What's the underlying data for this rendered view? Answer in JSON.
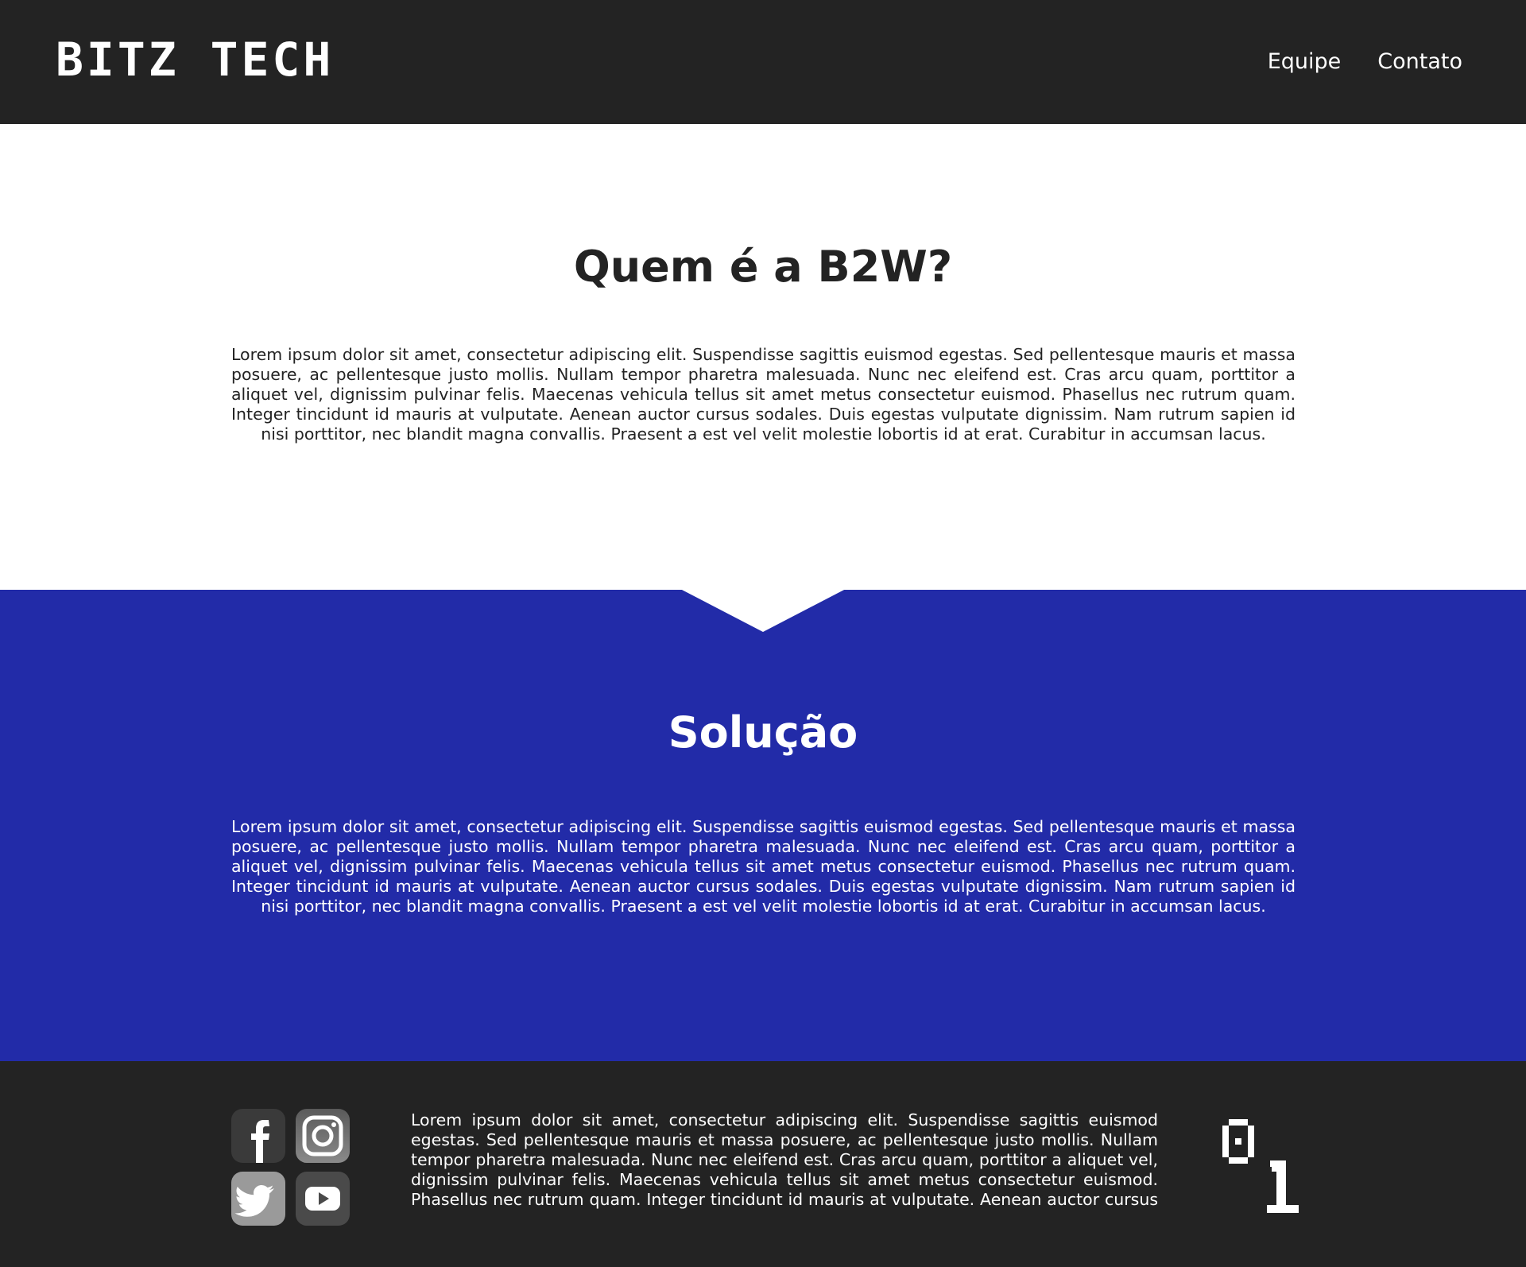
{
  "header": {
    "logo": "BITZ TECH",
    "nav": [
      {
        "label": "Equipe"
      },
      {
        "label": "Contato"
      }
    ]
  },
  "about": {
    "title": "Quem é a B2W?",
    "text": "Lorem ipsum dolor sit amet, consectetur adipiscing elit. Suspendisse sagittis euismod egestas. Sed pellentesque mauris et massa posuere, ac pellentesque justo mollis. Nullam tempor pharetra malesuada. Nunc nec eleifend est. Cras arcu quam, porttitor a aliquet vel, dignissim pulvinar felis. Maecenas vehicula tellus sit amet metus consectetur euismod. Phasellus nec rutrum quam. Integer tincidunt id mauris at vulputate. Aenean auctor cursus sodales. Duis egestas vulputate dignissim. Nam rutrum sapien id nisi porttitor, nec blandit magna convallis. Praesent a est vel velit molestie lobortis id at erat. Curabitur in accumsan lacus."
  },
  "solution": {
    "title": "Solução",
    "text": "Lorem ipsum dolor sit amet, consectetur adipiscing elit. Suspendisse sagittis euismod egestas. Sed pellentesque mauris et massa posuere, ac pellentesque justo mollis. Nullam tempor pharetra malesuada. Nunc nec eleifend est. Cras arcu quam, porttitor a aliquet vel, dignissim pulvinar felis. Maecenas vehicula tellus sit amet metus consectetur euismod. Phasellus nec rutrum quam. Integer tincidunt id mauris at vulputate. Aenean auctor cursus sodales. Duis egestas vulputate dignissim. Nam rutrum sapien id nisi porttitor, nec blandit magna convallis. Praesent a est vel velit molestie lobortis id at erat. Curabitur in accumsan lacus."
  },
  "footer": {
    "social": [
      {
        "icon": "facebook-icon"
      },
      {
        "icon": "instagram-icon"
      },
      {
        "icon": "twitter-icon"
      },
      {
        "icon": "youtube-icon"
      }
    ],
    "text": "Lorem ipsum dolor sit amet, consectetur adipiscing elit. Suspendisse sagittis euismod egestas. Sed pellentesque mauris et massa posuere, ac pellentesque justo mollis. Nullam tempor pharetra malesuada. Nunc nec eleifend est. Cras arcu quam, porttitor a aliquet vel, dignissim pulvinar felis. Maecenas vehicula tellus sit amet metus consectetur euismod. Phasellus nec rutrum quam. Integer tincidunt id mauris at vulputate. Aenean auctor cursus sodales. Duis egestas vulputate dignissim. Nam",
    "logo_icon": "binary-01-logo"
  },
  "colors": {
    "header_bg": "#232323",
    "solution_bg": "#222ba8",
    "footer_bg": "#232323",
    "text_dark": "#232323",
    "text_light": "#ffffff"
  }
}
